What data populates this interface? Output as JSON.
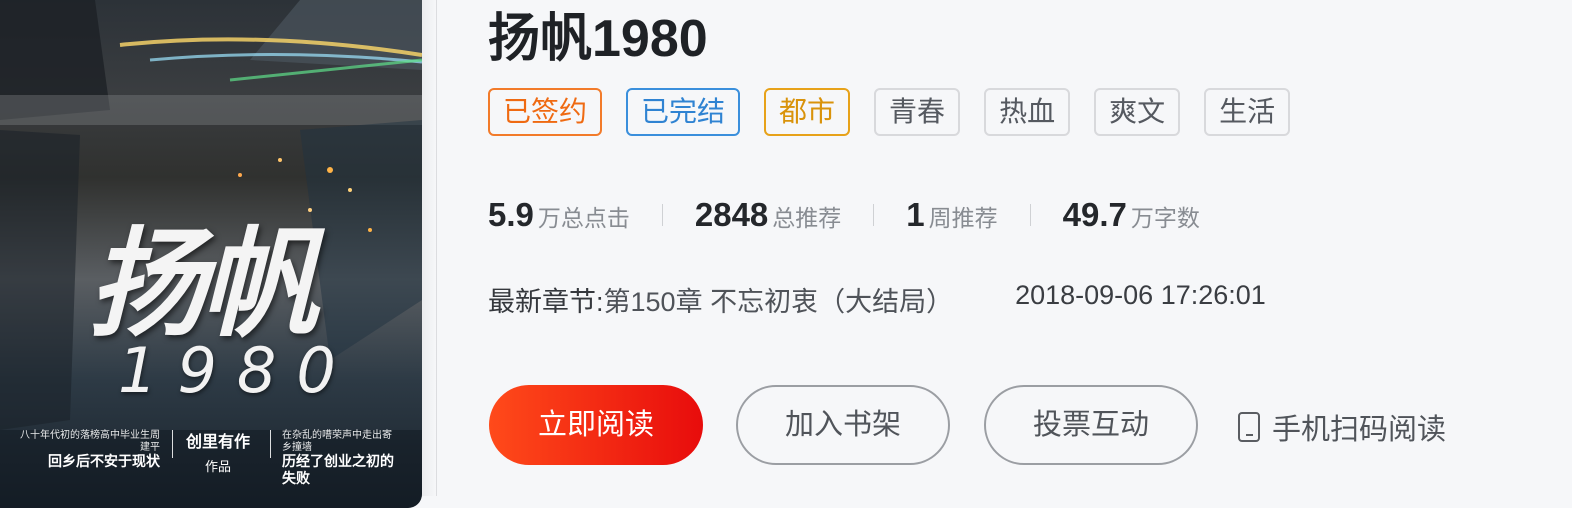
{
  "cover": {
    "title": "扬帆",
    "year": "1980",
    "left_small": "八十年代初的落榜高中毕业生周建平",
    "left_big": "回乡后不安于现状",
    "author": "创里有作",
    "author_sub": "作品",
    "right_small": "在杂乱的嘈荣声中走出寄乡撞墙",
    "right_big": "历经了创业之初的失败"
  },
  "book": {
    "title": "扬帆1980",
    "tags": [
      "已签约",
      "已完结",
      "都市",
      "青春",
      "热血",
      "爽文",
      "生活"
    ]
  },
  "stats": [
    {
      "value": "5.9",
      "label": "万总点击"
    },
    {
      "value": "2848",
      "label": "总推荐"
    },
    {
      "value": "1",
      "label": "周推荐"
    },
    {
      "value": "49.7",
      "label": "万字数"
    }
  ],
  "latest": {
    "label": "最新章节:",
    "chapter": "第150章 不忘初衷（大结局）",
    "time": "2018-09-06 17:26:01"
  },
  "actions": {
    "read": "立即阅读",
    "shelf": "加入书架",
    "vote": "投票互动",
    "mobile": "手机扫码阅读"
  }
}
